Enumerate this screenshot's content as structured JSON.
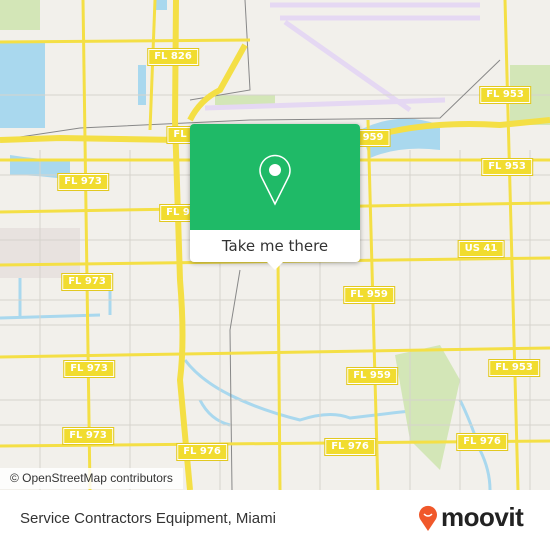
{
  "map": {
    "shields": [
      {
        "label": "FL 826"
      },
      {
        "label": "FL 953"
      },
      {
        "label": "FL"
      },
      {
        "label": "959"
      },
      {
        "label": "FL 953"
      },
      {
        "label": "FL 973"
      },
      {
        "label": "FL 9"
      },
      {
        "label": "FL 973"
      },
      {
        "label": "US 41"
      },
      {
        "label": "FL 959"
      },
      {
        "label": "FL 973"
      },
      {
        "label": "FL 959"
      },
      {
        "label": "FL 953"
      },
      {
        "label": "FL 973"
      },
      {
        "label": "FL 976"
      },
      {
        "label": "FL 976"
      },
      {
        "label": "FL 976"
      }
    ],
    "attribution": "© OpenStreetMap contributors",
    "colors": {
      "road": "#f4df45",
      "water": "#a9d8ee",
      "land": "#f2f0eb",
      "park": "#d3e6b7",
      "airport": "#e5d8f3"
    }
  },
  "popup": {
    "action_label": "Take me there",
    "pin_icon": "map-pin-icon",
    "color": "#1fba67"
  },
  "footer": {
    "place_name": "Service Contractors Equipment, Miami",
    "brand": "moovit",
    "brand_color": "#f0582a"
  }
}
